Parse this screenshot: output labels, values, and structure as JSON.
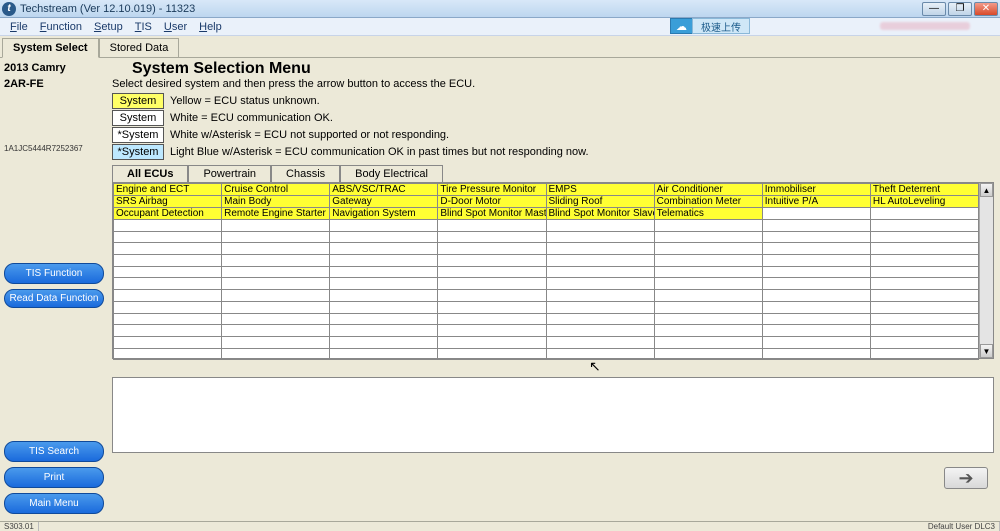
{
  "window": {
    "title": "Techstream (Ver 12.10.019) - 11323"
  },
  "menubar": {
    "items": [
      "File",
      "Function",
      "Setup",
      "TIS",
      "User",
      "Help"
    ],
    "upload_label": "极速上传"
  },
  "tabs": {
    "system_select": "System Select",
    "stored_data": "Stored Data"
  },
  "vehicle": {
    "model": "2013 Camry",
    "engine": "2AR-FE",
    "vin": "1A1JC5444R7252367"
  },
  "side_buttons": {
    "tis_function": "TIS Function",
    "read_data": "Read Data Function",
    "tis_search": "TIS Search",
    "print": "Print",
    "main_menu": "Main Menu"
  },
  "content": {
    "heading": "System Selection Menu",
    "instruction": "Select desired system and then press the arrow button to access the ECU.",
    "legend": [
      {
        "box_class": "yellow",
        "box_text": "System",
        "desc": "Yellow = ECU status unknown."
      },
      {
        "box_class": "white",
        "box_text": "System",
        "desc": "White = ECU communication OK."
      },
      {
        "box_class": "white",
        "box_text": "*System",
        "desc": "White w/Asterisk = ECU not supported or not responding."
      },
      {
        "box_class": "lightblue",
        "box_text": "*System",
        "desc": "Light Blue w/Asterisk = ECU communication OK in past times but not responding now."
      }
    ],
    "subtabs": [
      "All ECUs",
      "Powertrain",
      "Chassis",
      "Body Electrical"
    ],
    "grid_rows": [
      [
        "Engine and ECT",
        "Cruise Control",
        "ABS/VSC/TRAC",
        "Tire Pressure Monitor",
        "EMPS",
        "Air Conditioner",
        "Immobiliser",
        "Theft Deterrent"
      ],
      [
        "SRS Airbag",
        "Main Body",
        "Gateway",
        "D-Door Motor",
        "Sliding Roof",
        "Combination Meter",
        "Intuitive P/A",
        "HL AutoLeveling"
      ],
      [
        "Occupant Detection",
        "Remote Engine Starter",
        "Navigation System",
        "Blind Spot Monitor Master",
        "Blind Spot Monitor Slave",
        "Telematics",
        "",
        ""
      ]
    ],
    "grid_status": [
      [
        "yellow",
        "yellow",
        "yellow",
        "yellow",
        "yellow",
        "yellow",
        "yellow",
        "yellow"
      ],
      [
        "yellow",
        "yellow",
        "yellow",
        "yellow",
        "yellow",
        "yellow",
        "yellow",
        "yellow"
      ],
      [
        "yellow",
        "yellow",
        "yellow",
        "yellow",
        "yellow",
        "yellow",
        "",
        ""
      ]
    ],
    "empty_rows": 12,
    "cols": 8
  },
  "statusbar": {
    "left": "S303.01",
    "right": "Default User         DLC3"
  }
}
